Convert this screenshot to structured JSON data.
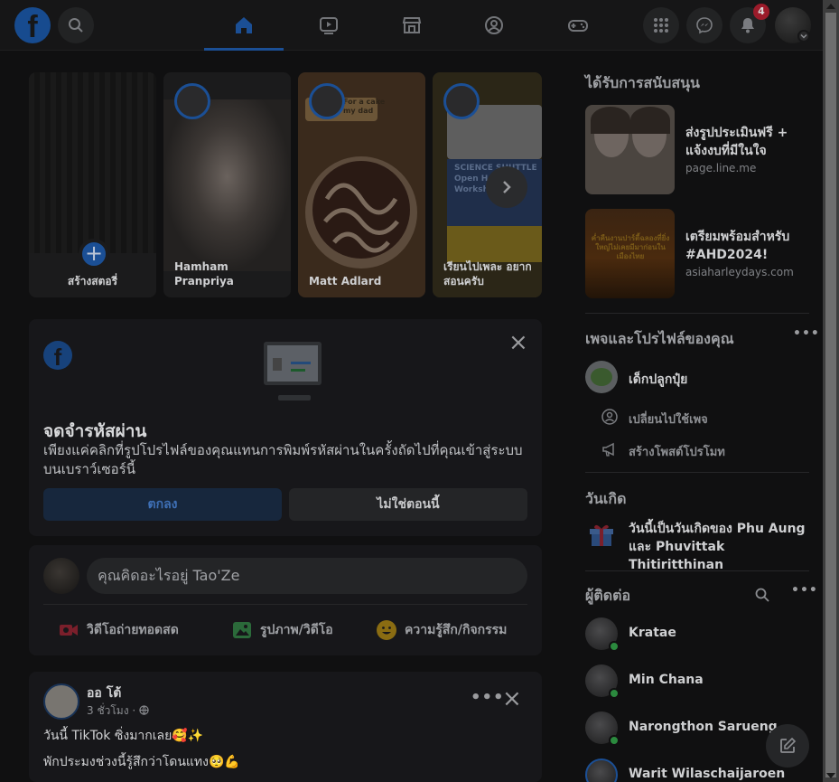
{
  "header": {
    "logo_letter": "f",
    "notification_count": "4"
  },
  "stories": {
    "create_label": "สร้างสตอรี่",
    "items": [
      {
        "name": "Hamham Pranpriya"
      },
      {
        "name": "Matt Adlard",
        "overlay_text": "For a cake\nmy dad"
      },
      {
        "name": "เรียนไปเพละ อยาก สอนครับ",
        "overlay_text": "SCIENCE SHUTTLE\nOpen H...\nWorkshop"
      }
    ]
  },
  "password_card": {
    "title": "จดจำรหัสผ่าน",
    "description": "เพียงแค่คลิกที่รูปโปรไฟล์ของคุณแทนการพิมพ์รหัสผ่านในครั้งถัดไปที่คุณเข้าสู่ระบบบนเบราว์เซอร์นี้",
    "ok_label": "ตกลง",
    "not_now_label": "ไม่ใช่ตอนนี้"
  },
  "composer": {
    "placeholder": "คุณคิดอะไรอยู่ Tao'Ze",
    "actions": [
      {
        "label": "วิดีโอถ่ายทอดสด",
        "icon": "live-video-icon",
        "color": "#7a1f2b"
      },
      {
        "label": "รูปภาพ/วิดีโอ",
        "icon": "photo-icon",
        "color": "#2b6a3a"
      },
      {
        "label": "ความรู้สึก/กิจกรรม",
        "icon": "feeling-icon",
        "color": "#8a6c12"
      }
    ]
  },
  "post": {
    "author": "ออ โต้",
    "time": "3 ชั่วโมง ·",
    "line1": "วันนี้ TikTok ซิ่งมากเลย🥰✨",
    "line2": "พักประมงช่วงนี้รู้สึกว่าโดนแทง🥺💪"
  },
  "sidebar": {
    "sponsored_heading": "ได้รับการสนับสนุน",
    "ads": [
      {
        "title": "ส่งรูปประเมินฟรี + แจ้งงบที่มีในใจ",
        "domain": "page.line.me"
      },
      {
        "title": "เตรียมพร้อมสำหรับ #AHD2024!",
        "domain": "asiaharleydays.com",
        "image_text": "ค่ำคืนงานปาร์ตี้ฉลองที่ยิ่งใหญ่ไม่เคยมีมาก่อนในเมืองไทย"
      }
    ],
    "pages_heading": "เพจและโปรไฟล์ของคุณ",
    "page_name": "เด็กปลูกปุ๋ย",
    "switch_label": "เปลี่ยนไปใช้เพจ",
    "promo_label": "สร้างโพสต์โปรโมท",
    "birthdays_heading": "วันเกิด",
    "birthday_text": "วันนี้เป็นวันเกิดของ Phu Aung และ Phuvittak Thitiritthinan",
    "contacts_heading": "ผู้ติดต่อ",
    "contacts": [
      {
        "name": "Kratae"
      },
      {
        "name": "Min Chana"
      },
      {
        "name": "Narongthon Sarueng"
      },
      {
        "name": "Warit Wilaschaijaroen"
      }
    ]
  },
  "colors": {
    "accent": "#1877f2",
    "overlay": "rgba(0,0,0,0.55)"
  }
}
